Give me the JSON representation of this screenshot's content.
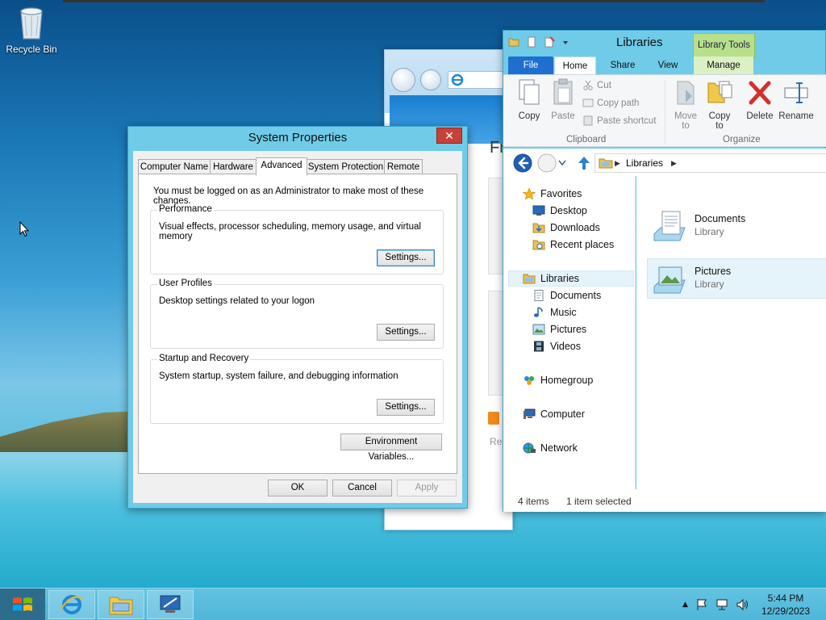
{
  "desktop": {
    "recycle_bin_label": "Recycle Bin"
  },
  "ie_window": {
    "partial_heading": "Fr",
    "partial_link": "Rec"
  },
  "system_properties": {
    "title": "System Properties",
    "close_glyph": "✕",
    "tabs": [
      "Computer Name",
      "Hardware",
      "Advanced",
      "System Protection",
      "Remote"
    ],
    "active_tab": "Advanced",
    "admin_note": "You must be logged on as an Administrator to make most of these changes.",
    "groups": [
      {
        "title": "Performance",
        "description": "Visual effects, processor scheduling, memory usage, and virtual memory",
        "button": "Settings..."
      },
      {
        "title": "User Profiles",
        "description": "Desktop settings related to your logon",
        "button": "Settings..."
      },
      {
        "title": "Startup and Recovery",
        "description": "System startup, system failure, and debugging information",
        "button": "Settings..."
      }
    ],
    "env_button": "Environment Variables...",
    "ok_button": "OK",
    "cancel_button": "Cancel",
    "apply_button": "Apply"
  },
  "explorer": {
    "title": "Libraries",
    "contextual_tab": "Library Tools",
    "ribbon_tabs": {
      "file": "File",
      "home": "Home",
      "share": "Share",
      "view": "View",
      "manage": "Manage"
    },
    "clipboard": {
      "copy": "Copy",
      "paste": "Paste",
      "cut": "Cut",
      "copy_path": "Copy path",
      "paste_shortcut": "Paste shortcut",
      "group_label": "Clipboard"
    },
    "organize": {
      "move_to_1": "Move",
      "move_to_2": "to",
      "copy_to_1": "Copy",
      "copy_to_2": "to",
      "delete": "Delete",
      "rename": "Rename",
      "group_label": "Organize"
    },
    "address": {
      "crumb": "Libraries"
    },
    "nav_pane": {
      "favorites": "Favorites",
      "desktop": "Desktop",
      "downloads": "Downloads",
      "recent": "Recent places",
      "libraries": "Libraries",
      "documents": "Documents",
      "music": "Music",
      "pictures": "Pictures",
      "videos": "Videos",
      "homegroup": "Homegroup",
      "computer": "Computer",
      "network": "Network"
    },
    "items": [
      {
        "name": "Documents",
        "type": "Library"
      },
      {
        "name": "Pictures",
        "type": "Library"
      }
    ],
    "status": {
      "count": "4 items",
      "selection": "1 item selected"
    }
  },
  "taskbar": {
    "time": "5:44 PM",
    "date": "12/29/2023",
    "tray_arrow": "▲"
  }
}
